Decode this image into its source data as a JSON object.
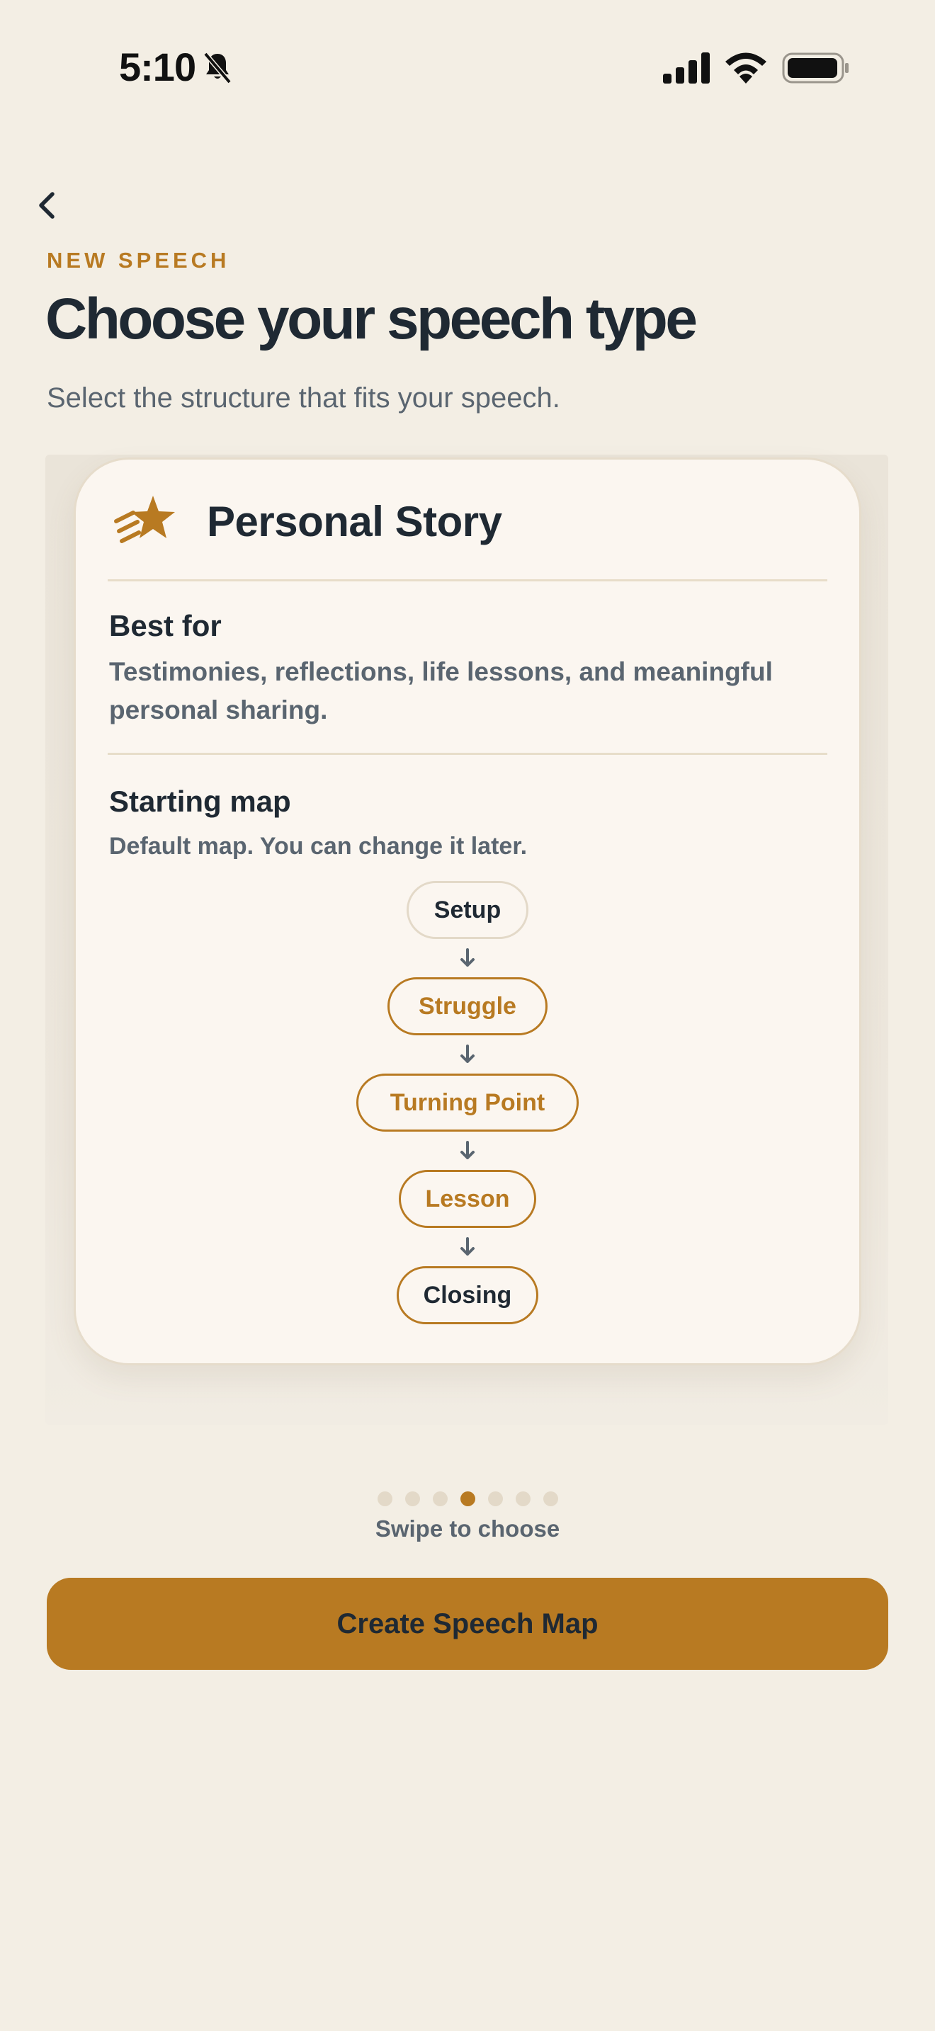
{
  "status_bar": {
    "time": "5:10",
    "icons": [
      "bell-slash-icon",
      "cellular-signal-icon",
      "wifi-icon",
      "battery-icon"
    ]
  },
  "header": {
    "back_icon": "chevron-left-icon",
    "eyebrow": "NEW SPEECH",
    "title": "Choose your speech type",
    "subtitle": "Select the structure that fits your speech."
  },
  "card": {
    "icon": "shooting-star-icon",
    "title": "Personal Story",
    "best_for_heading": "Best for",
    "best_for_text": "Testimonies, reflections, life lessons, and meaningful personal sharing.",
    "map_heading": "Starting map",
    "map_caption": "Default map. You can change it later.",
    "map_steps": [
      {
        "label": "Setup",
        "style": "neutral"
      },
      {
        "label": "Struggle",
        "style": "accent"
      },
      {
        "label": "Turning Point",
        "style": "accent"
      },
      {
        "label": "Lesson",
        "style": "accent"
      },
      {
        "label": "Closing",
        "style": "closing"
      }
    ]
  },
  "pagination": {
    "total": 7,
    "current": 4,
    "hint": "Swipe to choose"
  },
  "cta": {
    "label": "Create Speech Map"
  },
  "colors": {
    "background": "#F3EEE4",
    "accent": "#B87A22",
    "text_primary": "#1F2933",
    "text_secondary": "#5A6570",
    "card_bg": "#FBF6F0"
  }
}
